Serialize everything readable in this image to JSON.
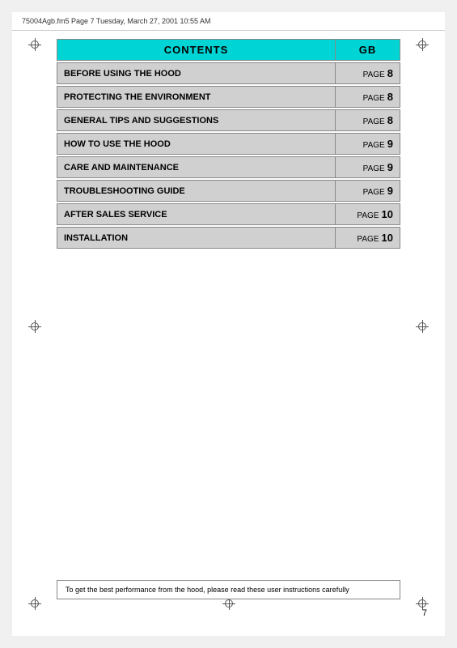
{
  "header": {
    "file_info": "75004Agb.fm5  Page 7  Tuesday, March 27, 2001  10:55 AM"
  },
  "contents": {
    "title": "CONTENTS",
    "gb_label": "GB",
    "items": [
      {
        "label": "BEFORE USING THE HOOD",
        "page_word": "PAGE",
        "page_num": "8"
      },
      {
        "label": "PROTECTING THE ENVIRONMENT",
        "page_word": "PAGE",
        "page_num": "8"
      },
      {
        "label": "GENERAL TIPS AND SUGGESTIONS",
        "page_word": "PAGE",
        "page_num": "8"
      },
      {
        "label": "HOW TO USE THE HOOD",
        "page_word": "PAGE",
        "page_num": "9"
      },
      {
        "label": "CARE AND MAINTENANCE",
        "page_word": "PAGE",
        "page_num": "9"
      },
      {
        "label": "TROUBLESHOOTING GUIDE",
        "page_word": "PAGE",
        "page_num": "9"
      },
      {
        "label": "AFTER SALES SERVICE",
        "page_word": "PAGE",
        "page_num": "10"
      },
      {
        "label": "INSTALLATION",
        "page_word": "PAGE",
        "page_num": "10"
      }
    ]
  },
  "bottom_note": {
    "text": "To get the best performance from the hood, please read these user instructions carefully"
  },
  "page_number": "7"
}
